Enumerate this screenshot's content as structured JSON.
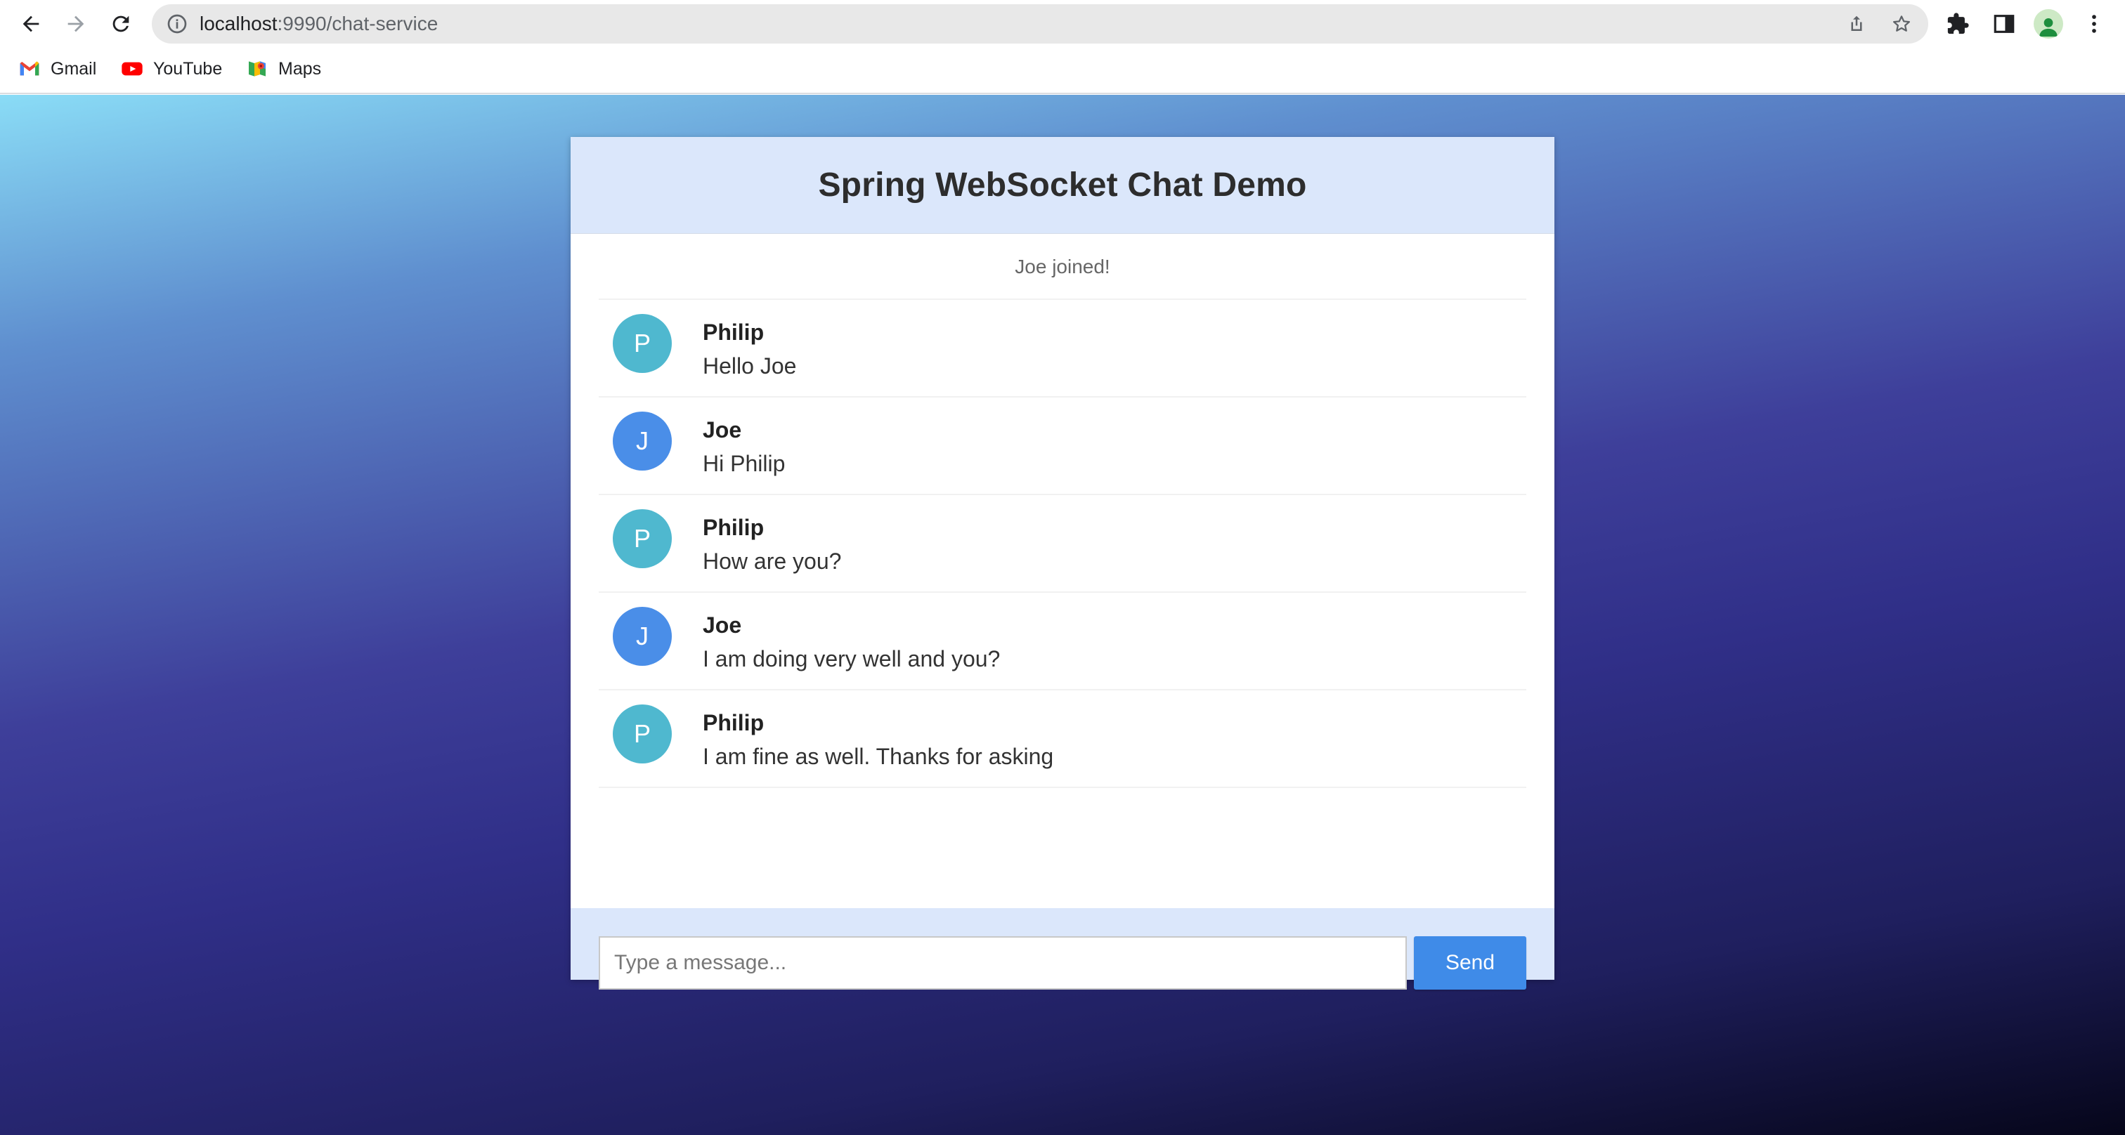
{
  "browser": {
    "url_host": "localhost",
    "url_path": ":9990/chat-service",
    "bookmarks": [
      {
        "label": "Gmail",
        "icon": "gmail-icon"
      },
      {
        "label": "YouTube",
        "icon": "youtube-icon"
      },
      {
        "label": "Maps",
        "icon": "maps-icon"
      }
    ]
  },
  "chat": {
    "title": "Spring WebSocket Chat Demo",
    "event": "Joe joined!",
    "messages": [
      {
        "sender": "Philip",
        "initial": "P",
        "text": "Hello Joe",
        "color": "#4fb8cf"
      },
      {
        "sender": "Joe",
        "initial": "J",
        "text": "Hi Philip",
        "color": "#4a8ee8"
      },
      {
        "sender": "Philip",
        "initial": "P",
        "text": "How are you?",
        "color": "#4fb8cf"
      },
      {
        "sender": "Joe",
        "initial": "J",
        "text": "I am doing very well and you?",
        "color": "#4a8ee8"
      },
      {
        "sender": "Philip",
        "initial": "P",
        "text": "I am fine as well. Thanks for asking",
        "color": "#4fb8cf"
      }
    ],
    "input_placeholder": "Type a message...",
    "send_label": "Send"
  }
}
